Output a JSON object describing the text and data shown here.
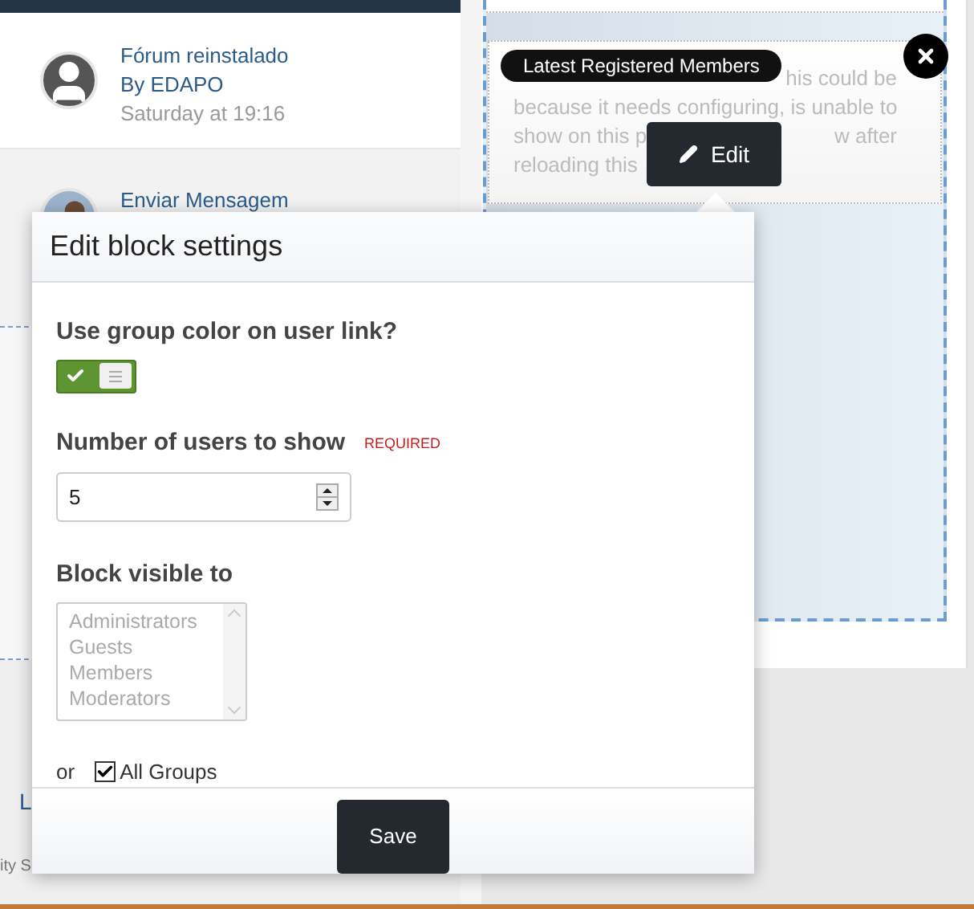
{
  "background": {
    "left_column": {
      "threads": [
        {
          "title": "Fórum reinstalado",
          "author": "By EDAPO",
          "time": "Saturday at 19:16"
        },
        {
          "title": "Enviar Mensagem"
        }
      ],
      "edge_fragments": [
        "L",
        "ity S"
      ]
    },
    "block": {
      "badge": "Latest Registered Members",
      "message_lines": [
        "his could be",
        "because it needs configuring, is unable to",
        "show on this p",
        "w after",
        "reloading this"
      ],
      "edit_button": "Edit"
    }
  },
  "dialog": {
    "title": "Edit block settings",
    "group_color": {
      "label": "Use group color on user link?",
      "on": true
    },
    "users": {
      "label": "Number of users to show",
      "badge": "REQUIRED",
      "value": "5"
    },
    "visibility": {
      "label": "Block visible to",
      "options": [
        {
          "label": "Administrators",
          "selected": false
        },
        {
          "label": "Guests",
          "selected": false
        },
        {
          "label": "Members",
          "selected": false
        },
        {
          "label": "Moderators",
          "selected": false
        }
      ],
      "or": "or",
      "all_groups": {
        "label": "All Groups",
        "checked": true
      }
    },
    "save": "Save"
  }
}
